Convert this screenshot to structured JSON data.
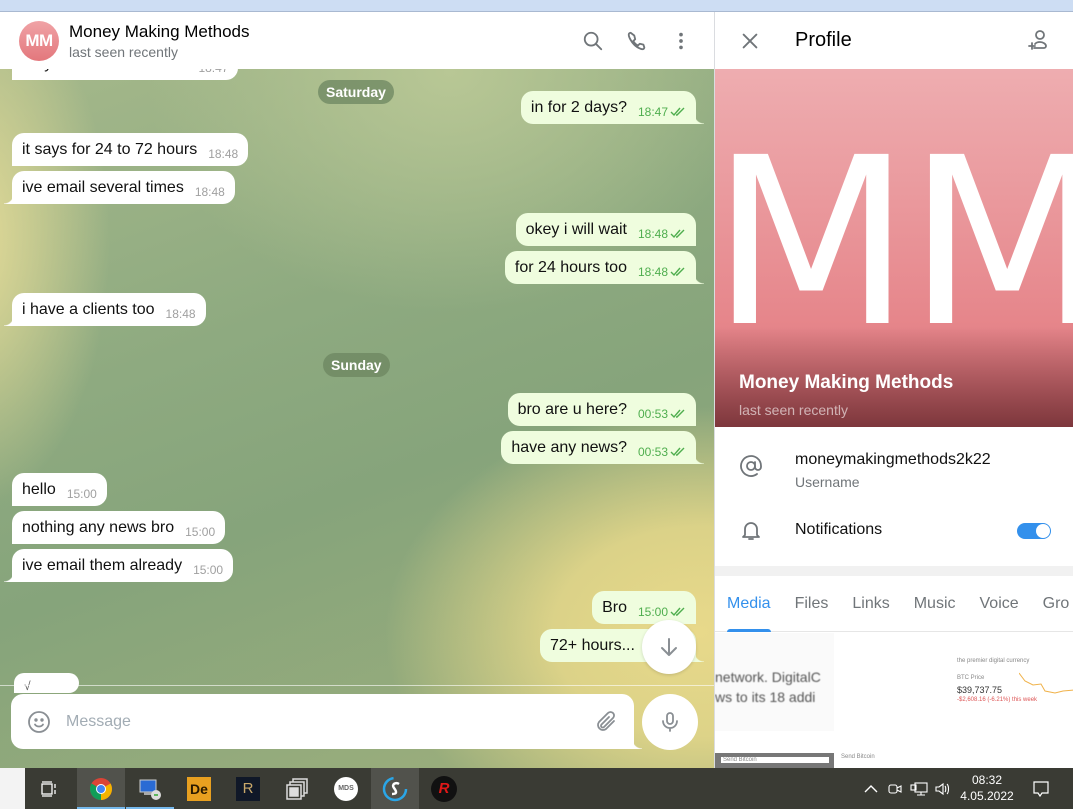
{
  "chat": {
    "title": "Money Making Methods",
    "status": "last seen recently",
    "avatar_initials": "MM",
    "partial_top_message": {
      "text": "they have maintenance",
      "time": "18:47"
    },
    "date_separators": [
      "Saturday",
      "Sunday"
    ],
    "messages": [
      {
        "dir": "out",
        "text": "in for 2 days?",
        "time": "18:47",
        "read": true
      },
      {
        "dir": "in",
        "text": "it says for 24 to 72 hours",
        "time": "18:48"
      },
      {
        "dir": "in",
        "text": "ive email several times",
        "time": "18:48"
      },
      {
        "dir": "out",
        "text": "okey i will wait",
        "time": "18:48",
        "read": true
      },
      {
        "dir": "out",
        "text": "for 24 hours too",
        "time": "18:48",
        "read": true
      },
      {
        "dir": "in",
        "text": "i have a clients too",
        "time": "18:48"
      },
      {
        "dir": "out",
        "text": "bro are u here?",
        "time": "00:53",
        "read": true
      },
      {
        "dir": "out",
        "text": "have any news?",
        "time": "00:53",
        "read": true
      },
      {
        "dir": "in",
        "text": "hello",
        "time": "15:00"
      },
      {
        "dir": "in",
        "text": "nothing any news bro",
        "time": "15:00"
      },
      {
        "dir": "in",
        "text": "ive email them already",
        "time": "15:00"
      },
      {
        "dir": "out",
        "text": "Bro",
        "time": "15:00",
        "read": true
      },
      {
        "dir": "out",
        "text": "72+ hours...",
        "time": "",
        "read": false
      }
    ],
    "partial_bottom_message": {
      "text": "√"
    },
    "composer": {
      "placeholder": "Message",
      "value": ""
    },
    "icons": {
      "search": "search-icon",
      "call": "phone-icon",
      "more": "more-vertical-icon",
      "emoji": "emoji-icon",
      "attach": "paperclip-icon",
      "mic": "microphone-icon",
      "scroll_down": "arrow-down-icon"
    }
  },
  "profile": {
    "header_title": "Profile",
    "banner_initials": "MM",
    "name": "Money Making Methods",
    "status": "last seen recently",
    "username": "moneymakingmethods2k22",
    "username_label": "Username",
    "notifications_label": "Notifications",
    "notifications_enabled": true,
    "tabs": [
      "Media",
      "Files",
      "Links",
      "Music",
      "Voice",
      "Gro"
    ],
    "active_tab": "Media",
    "media_thumbs": {
      "thumb1_line1": "network. DigitalC",
      "thumb1_line2": "ws to its 18 addi",
      "thumb3_tagline": "the premier digital currency",
      "thumb3_label": "BTC Price",
      "thumb3_price": "$39,737.75",
      "thumb3_change": "-$2,608.16 (-6.21%) this week",
      "thumb_send_title": "Send Bitcoin"
    },
    "accent_color": "#3390ec"
  },
  "taskbar": {
    "apps": [
      "task-view",
      "chrome",
      "remote-desktop",
      "de-app",
      "r-app",
      "multi-window",
      "mds",
      "s-app",
      "redline"
    ],
    "time": "08:32",
    "date": "4.05.2022"
  }
}
